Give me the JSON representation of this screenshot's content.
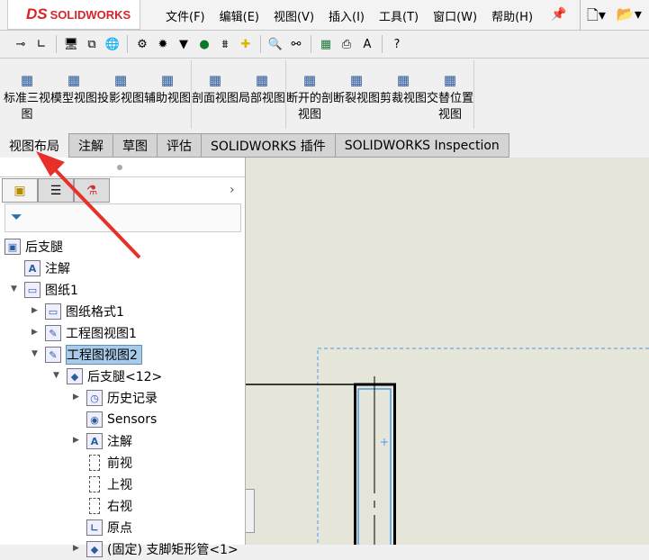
{
  "app": {
    "logo_text": "SOLIDWORKS",
    "logo_mark": "DS"
  },
  "menu": [
    "文件(F)",
    "编辑(E)",
    "视图(V)",
    "插入(I)",
    "工具(T)",
    "窗口(W)",
    "帮助(H)"
  ],
  "command_groups": [
    [
      {
        "label": "标准三视图",
        "icon": "standard-3-view-icon"
      },
      {
        "label": "模型视图",
        "icon": "model-view-icon"
      },
      {
        "label": "投影视图",
        "icon": "projected-view-icon"
      },
      {
        "label": "辅助视图",
        "icon": "auxiliary-view-icon"
      }
    ],
    [
      {
        "label": "剖面视图",
        "icon": "section-view-icon"
      },
      {
        "label": "局部视图",
        "icon": "detail-view-icon"
      }
    ],
    [
      {
        "label": "断开的剖视图",
        "icon": "broken-out-section-icon"
      },
      {
        "label": "断裂视图",
        "icon": "break-view-icon"
      },
      {
        "label": "剪裁视图",
        "icon": "crop-view-icon"
      },
      {
        "label": "交替位置视图",
        "icon": "alternate-position-icon"
      }
    ]
  ],
  "tabs": [
    "视图布局",
    "注解",
    "草图",
    "评估",
    "SOLIDWORKS 插件",
    "SOLIDWORKS Inspection"
  ],
  "active_tab": "视图布局",
  "tree": [
    {
      "label": "后支腿",
      "level": 0,
      "arrow": "",
      "icon": "drawing-icon"
    },
    {
      "label": "注解",
      "level": 1,
      "arrow": "",
      "icon": "annotations-icon"
    },
    {
      "label": "图纸1",
      "level": 1,
      "arrow": "down",
      "icon": "sheet-icon"
    },
    {
      "label": "图纸格式1",
      "level": 2,
      "arrow": "right",
      "icon": "sheet-format-icon"
    },
    {
      "label": "工程图视图1",
      "level": 2,
      "arrow": "right",
      "icon": "drawing-view-icon"
    },
    {
      "label": "工程图视图2",
      "level": 2,
      "arrow": "down",
      "icon": "drawing-view-icon",
      "selected": true
    },
    {
      "label": "后支腿<12>",
      "level": 3,
      "arrow": "down",
      "icon": "part-icon"
    },
    {
      "label": "历史记录",
      "level": 4,
      "arrow": "right",
      "icon": "history-icon"
    },
    {
      "label": "Sensors",
      "level": 4,
      "arrow": "",
      "icon": "sensors-icon"
    },
    {
      "label": "注解",
      "level": 4,
      "arrow": "right",
      "icon": "annotations-icon"
    },
    {
      "label": "前视",
      "level": 4,
      "arrow": "",
      "icon": "plane-icon"
    },
    {
      "label": "上视",
      "level": 4,
      "arrow": "",
      "icon": "plane-icon"
    },
    {
      "label": "右视",
      "level": 4,
      "arrow": "",
      "icon": "plane-icon"
    },
    {
      "label": "原点",
      "level": 4,
      "arrow": "",
      "icon": "origin-icon"
    },
    {
      "label": "(固定) 支脚矩形管<1>",
      "level": 4,
      "arrow": "right",
      "icon": "part-icon"
    }
  ],
  "colors": {
    "canvas": "#e5e5da",
    "selection": "#a8cbe9",
    "annotation_arrow": "#e8302a",
    "view_border": "#4a9be8"
  }
}
